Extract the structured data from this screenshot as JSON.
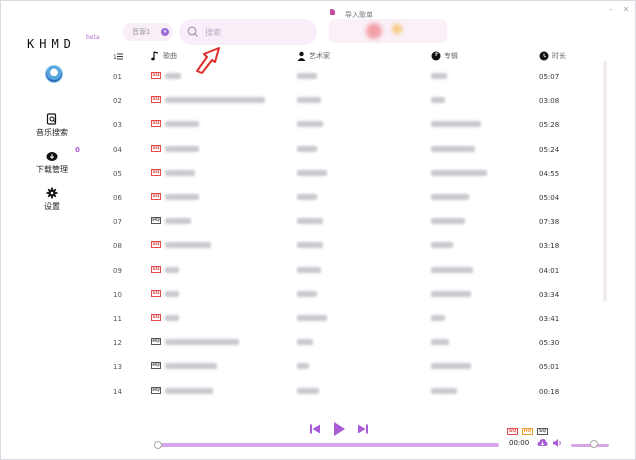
{
  "window": {
    "title": "导入歌单"
  },
  "sidebar": {
    "logo": "KHMD",
    "badge": "beta",
    "items": [
      {
        "label": "音乐搜索",
        "icon": "music-search-icon"
      },
      {
        "label": "下载管理",
        "icon": "download-icon"
      },
      {
        "label": "设置",
        "icon": "gear-icon"
      }
    ],
    "download_count": "0"
  },
  "header": {
    "source": "音源1",
    "search_placeholder": "搜索"
  },
  "table": {
    "columns": [
      "歌曲",
      "艺术家",
      "专辑",
      "时长"
    ],
    "rows": [
      {
        "num": "01",
        "quality": "SQ",
        "duration": "05:07"
      },
      {
        "num": "02",
        "quality": "SQ",
        "duration": "03:08"
      },
      {
        "num": "03",
        "quality": "SQ",
        "duration": "05:28"
      },
      {
        "num": "04",
        "quality": "SQ",
        "duration": "05:24"
      },
      {
        "num": "05",
        "quality": "SQ",
        "duration": "04:55"
      },
      {
        "num": "06",
        "quality": "SQ",
        "duration": "05:04"
      },
      {
        "num": "07",
        "quality": "HQ",
        "duration": "07:38"
      },
      {
        "num": "08",
        "quality": "SQ",
        "duration": "03:18"
      },
      {
        "num": "09",
        "quality": "SQ",
        "duration": "04:01"
      },
      {
        "num": "10",
        "quality": "SQ",
        "duration": "03:34"
      },
      {
        "num": "11",
        "quality": "SQ",
        "duration": "03:41"
      },
      {
        "num": "12",
        "quality": "HQ",
        "duration": "05:30"
      },
      {
        "num": "13",
        "quality": "HQ",
        "duration": "05:01"
      },
      {
        "num": "14",
        "quality": "HQ",
        "duration": "00:18"
      }
    ]
  },
  "player": {
    "time": "00:00",
    "quality_tags": [
      "SQ",
      "HQ",
      "SQ"
    ],
    "progress": 0,
    "volume": 0.6
  },
  "colors": {
    "accent": "#b36fd6",
    "sq_tag": "#e44a4a",
    "hq_tag": "#555555"
  }
}
